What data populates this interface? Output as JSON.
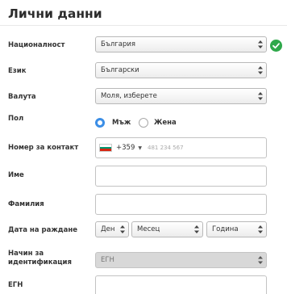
{
  "section": {
    "title": "Лични данни"
  },
  "fields": {
    "nationality": {
      "label": "Националност",
      "value": "България"
    },
    "language": {
      "label": "Език",
      "value": "Български"
    },
    "currency": {
      "label": "Валута",
      "value": "Моля, изберете"
    },
    "gender": {
      "label": "Пол",
      "options": [
        "Мъж",
        "Жена"
      ],
      "selected": "Мъж"
    },
    "phone": {
      "label": "Номер за контакт",
      "prefix": "+359",
      "placeholder": "481 234 567"
    },
    "first_name": {
      "label": "Име",
      "value": ""
    },
    "last_name": {
      "label": "Фамилия",
      "value": ""
    },
    "birth_date": {
      "label": "Дата на раждане",
      "day": "Ден",
      "month": "Месец",
      "year": "Година"
    },
    "id_method": {
      "label": "Начин за идентификация",
      "value": "ЕГН"
    },
    "egn": {
      "label": "ЕГН",
      "value": ""
    }
  },
  "colors": {
    "accent": "#3b8ee6",
    "valid": "#2ea84a",
    "flag": [
      "#ffffff",
      "#00966e",
      "#d62612"
    ]
  },
  "icons": {
    "valid": "check-circle-icon",
    "select": "select-arrows-icon",
    "flag": "bulgaria-flag-icon"
  }
}
